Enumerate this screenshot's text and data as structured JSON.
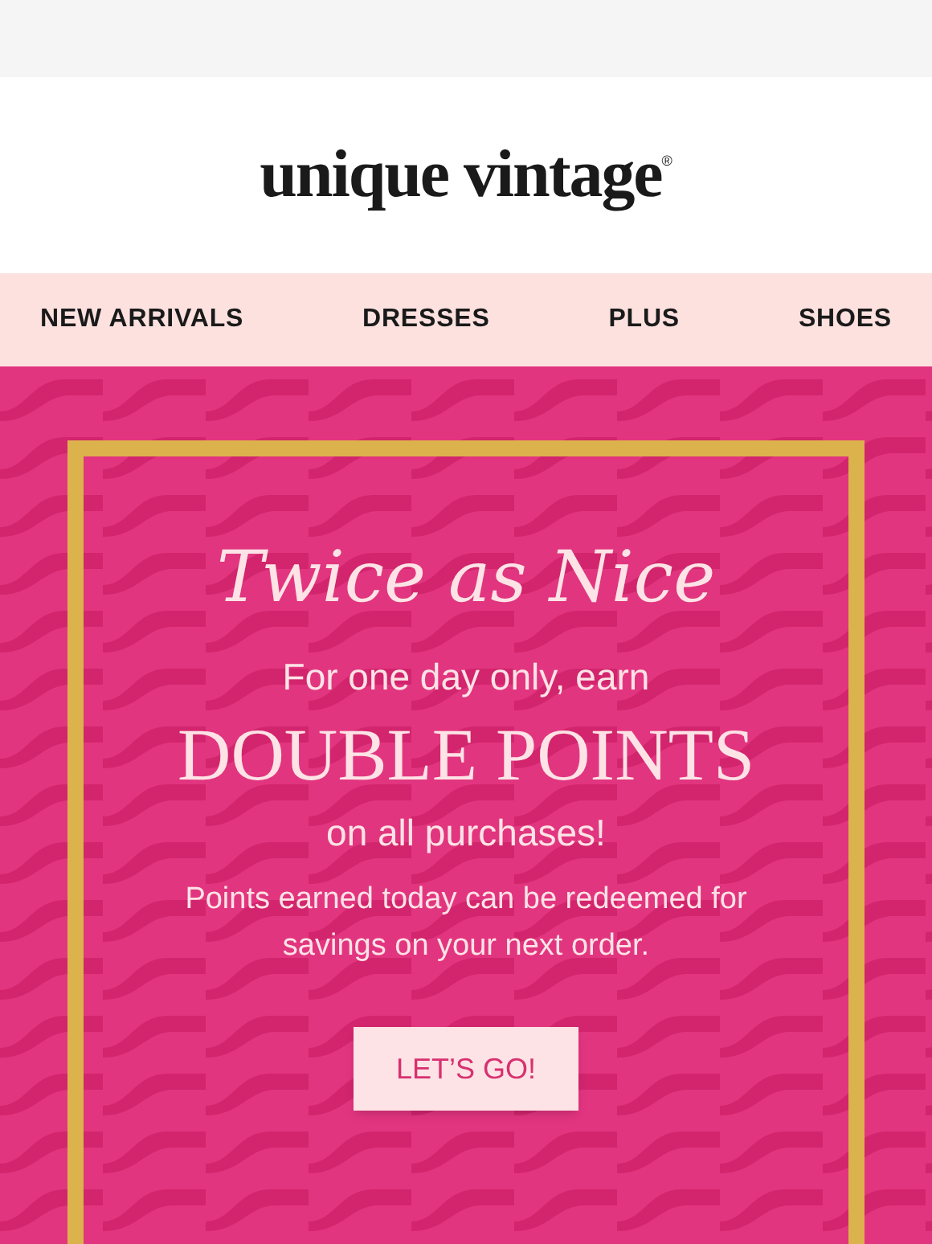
{
  "header": {
    "logo": "unique vintage",
    "logo_mark": "®"
  },
  "nav": [
    "NEW ARRIVALS",
    "DRESSES",
    "PLUS",
    "SHOES"
  ],
  "promo": {
    "title": "Twice as Nice",
    "line_1": "For one day only, earn",
    "headline": "DOUBLE POINTS",
    "line_2": "on all purchases!",
    "note": "Points earned today can be redeemed for savings on your next order.",
    "button": "LET’S GO!"
  }
}
